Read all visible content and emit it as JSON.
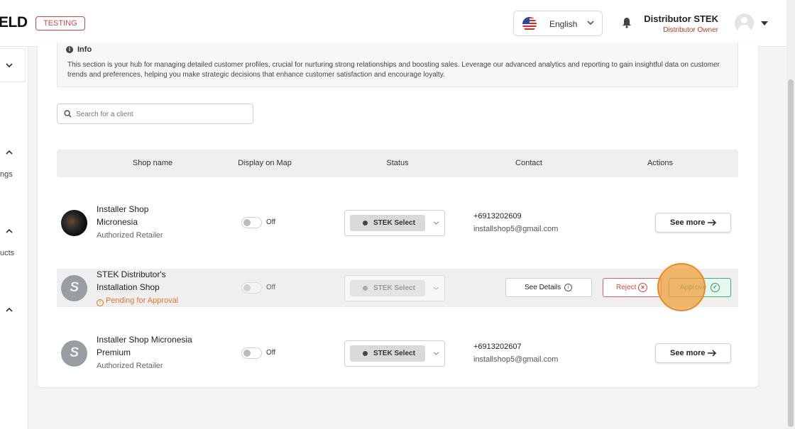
{
  "header": {
    "logo": "ELD",
    "env_badge": "TESTING",
    "language": {
      "label": "English",
      "flag_icon": "us-flag-icon"
    },
    "user": {
      "name": "Distributor STEK",
      "role": "Distributor Owner"
    }
  },
  "sidebar": {
    "partial_labels": [
      "ngs",
      "ucts"
    ]
  },
  "info": {
    "title": "Info",
    "text": "This section is your hub for managing detailed customer profiles, crucial for nurturing strong relationships and boosting sales. Leverage our advanced analytics and reporting to gain insightful data on customer trends and preferences, helping you make strategic decisions that enhance customer satisfaction and encourage loyalty."
  },
  "search": {
    "placeholder": "Search for a client",
    "value": ""
  },
  "table": {
    "columns": [
      "Shop name",
      "Display on Map",
      "Status",
      "Contact",
      "Actions"
    ],
    "rows": [
      {
        "name": "Installer Shop Micronesia",
        "subtitle": "Authorized Retailer",
        "map": "Off",
        "status": "STEK Select",
        "phone": "+6913202609",
        "email": "installshop5@gmail.com",
        "action": "See more"
      },
      {
        "name": "STEK Distributor's Installation Shop",
        "subtitle": "Pending for Approval",
        "map": "Off",
        "status": "STEK Select",
        "see_details": "See Details",
        "reject": "Reject",
        "approve": "Approve"
      },
      {
        "name": "Installer Shop Micronesia Premium",
        "subtitle": "Authorized Retailer",
        "map": "Off",
        "status": "STEK Select",
        "phone": "+6913202607",
        "email": "installshop5@gmail.com",
        "action": "See more"
      }
    ]
  },
  "colors": {
    "accent_red": "#d64545",
    "pending_orange": "#e8742a",
    "approve_green": "#2e9c66"
  }
}
